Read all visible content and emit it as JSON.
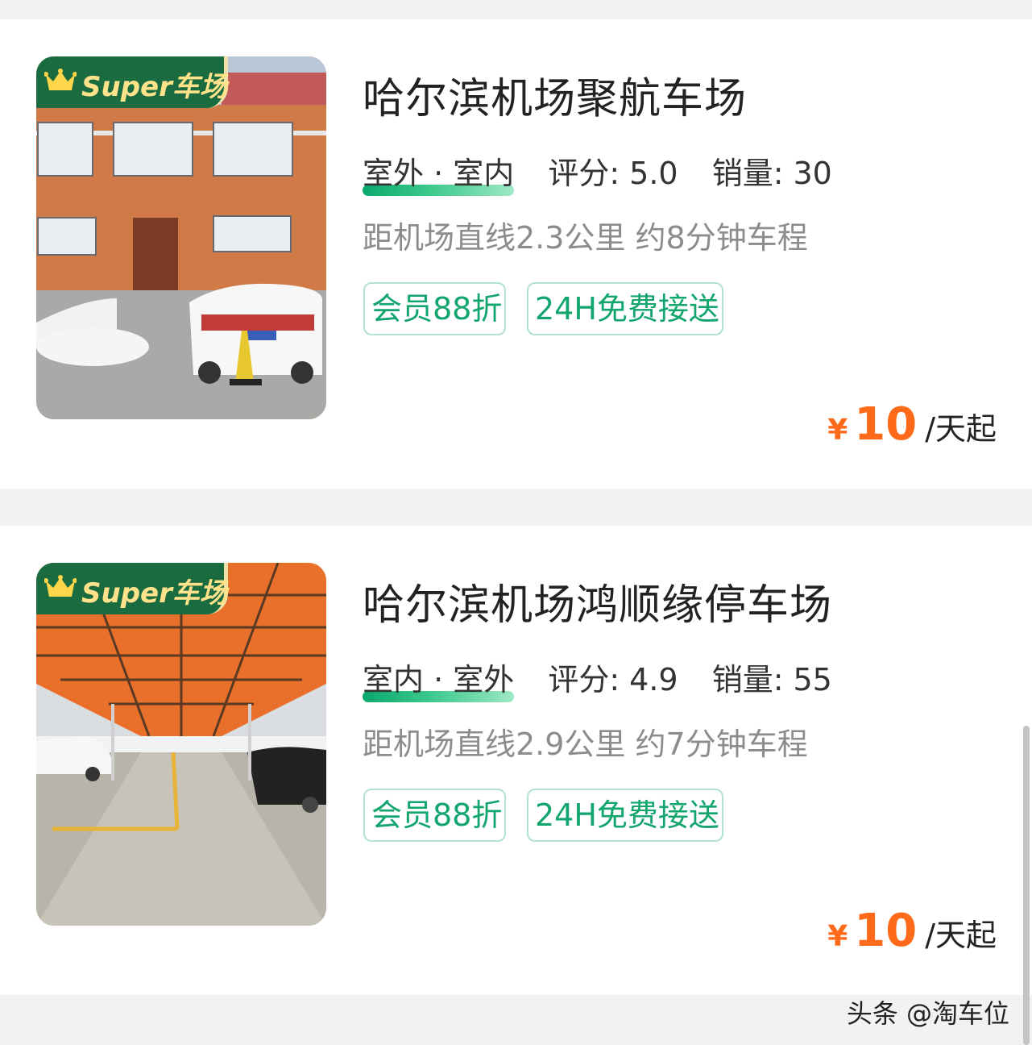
{
  "lots": [
    {
      "badge": "Super车场",
      "name": "哈尔滨机场聚航车场",
      "env": "室外 · 室内",
      "rating_label": "评分:",
      "rating": "5.0",
      "sales_label": "销量:",
      "sales": "30",
      "distance": "距机场直线2.3公里 约8分钟车程",
      "tags": [
        "会员88折",
        "24H免费接送"
      ],
      "price_symbol": "¥",
      "price": "10",
      "price_unit": "/天起"
    },
    {
      "badge": "Super车场",
      "name": "哈尔滨机场鸿顺缘停车场",
      "env": "室内 · 室外",
      "rating_label": "评分:",
      "rating": "4.9",
      "sales_label": "销量:",
      "sales": "55",
      "distance": "距机场直线2.9公里 约7分钟车程",
      "tags": [
        "会员88折",
        "24H免费接送"
      ],
      "price_symbol": "¥",
      "price": "10",
      "price_unit": "/天起"
    }
  ],
  "watermark": "头条 @淘车位",
  "colors": {
    "accent_green": "#12a56e",
    "price_orange": "#ff6a1a",
    "badge_green": "#1a6b3f",
    "badge_text": "#ffe28a"
  },
  "icons": [
    "crown-icon"
  ]
}
